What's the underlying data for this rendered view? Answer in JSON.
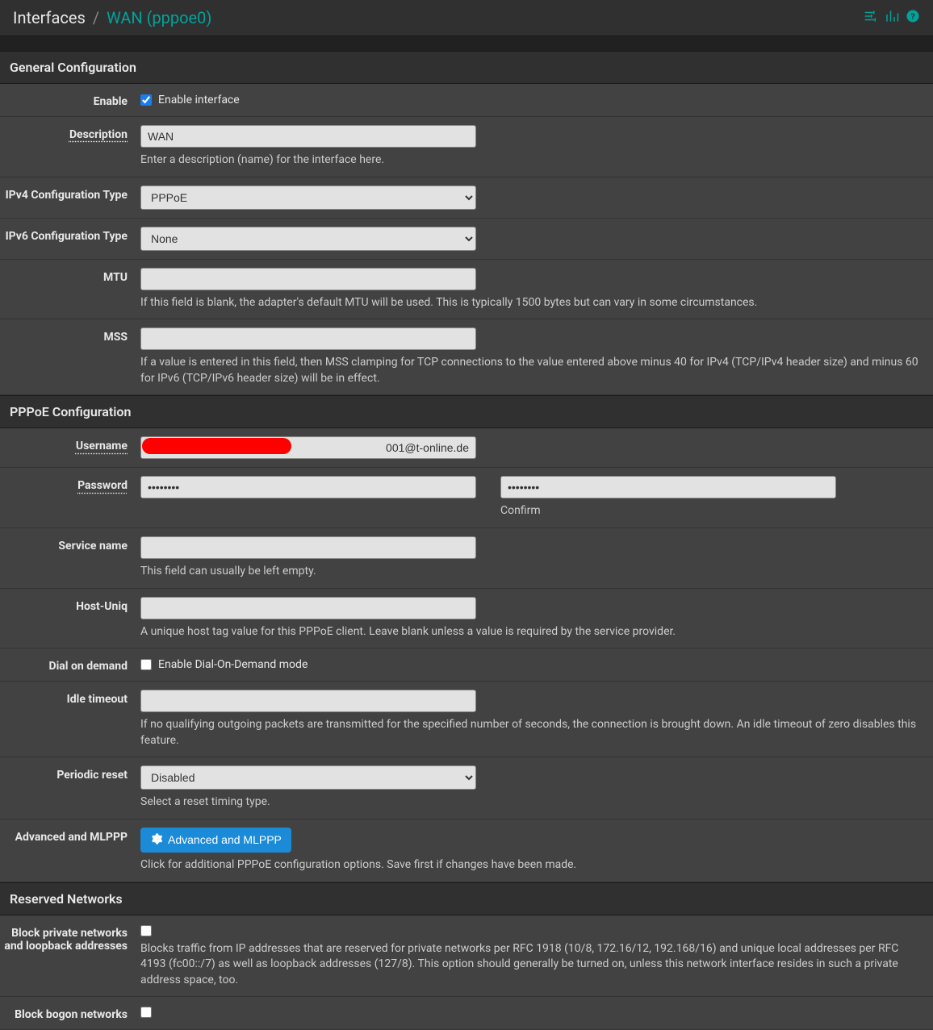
{
  "breadcrumb": {
    "root": "Interfaces",
    "current": "WAN (pppoe0)"
  },
  "sections": {
    "general": {
      "title": "General Configuration",
      "enable": {
        "label": "Enable",
        "checkbox_label": "Enable interface",
        "checked": true
      },
      "description": {
        "label": "Description",
        "value": "WAN",
        "help": "Enter a description (name) for the interface here."
      },
      "ipv4type": {
        "label": "IPv4 Configuration Type",
        "value": "PPPoE"
      },
      "ipv6type": {
        "label": "IPv6 Configuration Type",
        "value": "None"
      },
      "mtu": {
        "label": "MTU",
        "value": "",
        "help": "If this field is blank, the adapter's default MTU will be used. This is typically 1500 bytes but can vary in some circumstances."
      },
      "mss": {
        "label": "MSS",
        "value": "",
        "help": "If a value is entered in this field, then MSS clamping for TCP connections to the value entered above minus 40 for IPv4 (TCP/IPv4 header size) and minus 60 for IPv6 (TCP/IPv6 header size) will be in effect."
      }
    },
    "pppoe": {
      "title": "PPPoE Configuration",
      "username": {
        "label": "Username",
        "value": "001@t-online.de"
      },
      "password": {
        "label": "Password",
        "value": "••••••••",
        "confirm_value": "••••••••",
        "confirm_label": "Confirm"
      },
      "service": {
        "label": "Service name",
        "value": "",
        "help": "This field can usually be left empty."
      },
      "hostuniq": {
        "label": "Host-Uniq",
        "value": "",
        "help": "A unique host tag value for this PPPoE client. Leave blank unless a value is required by the service provider."
      },
      "dialondemand": {
        "label": "Dial on demand",
        "checkbox_label": "Enable Dial-On-Demand mode",
        "checked": false
      },
      "idletimeout": {
        "label": "Idle timeout",
        "value": "",
        "help": "If no qualifying outgoing packets are transmitted for the specified number of seconds, the connection is brought down. An idle timeout of zero disables this feature."
      },
      "periodicreset": {
        "label": "Periodic reset",
        "value": "Disabled",
        "help": "Select a reset timing type."
      },
      "advanced": {
        "label": "Advanced and MLPPP",
        "button": "Advanced and MLPPP",
        "help": "Click for additional PPPoE configuration options. Save first if changes have been made."
      }
    },
    "reserved": {
      "title": "Reserved Networks",
      "blockpriv": {
        "label": "Block private networks and loopback addresses",
        "checked": false,
        "help": "Blocks traffic from IP addresses that are reserved for private networks per RFC 1918 (10/8, 172.16/12, 192.168/16) and unique local addresses per RFC 4193 (fc00::/7) as well as loopback addresses (127/8). This option should generally be turned on, unless this network interface resides in such a private address space, too."
      },
      "blockbogon": {
        "label": "Block bogon networks",
        "checked": false
      }
    }
  }
}
